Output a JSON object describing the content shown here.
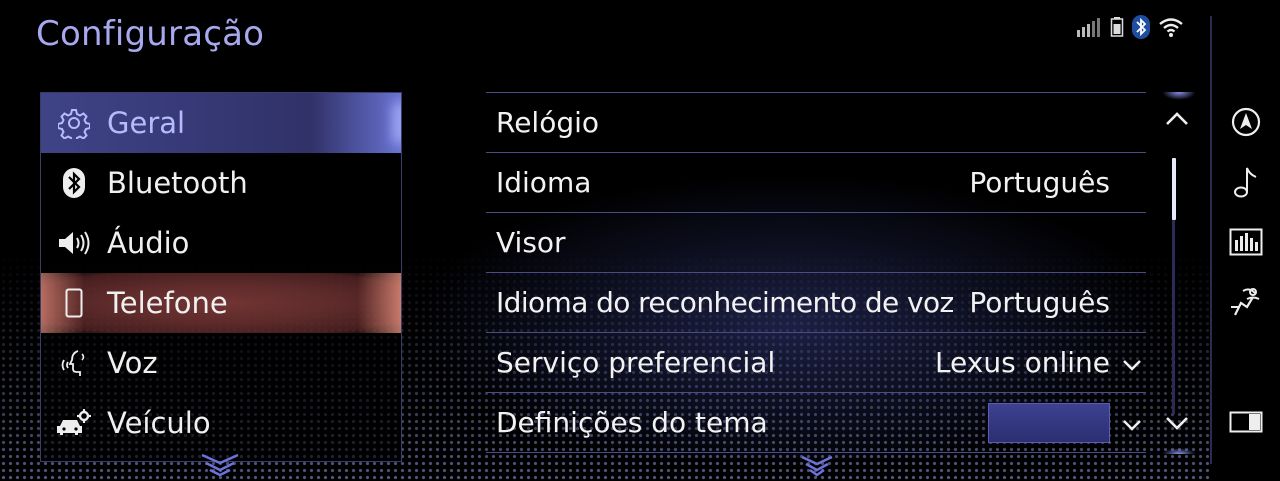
{
  "header": {
    "title": "Configuração"
  },
  "status": [
    "signal-icon",
    "phone-battery-icon",
    "bluetooth-icon",
    "wifi-icon"
  ],
  "menu": {
    "items": [
      {
        "label": "Geral",
        "icon": "gear-icon",
        "state": "selected"
      },
      {
        "label": "Bluetooth",
        "icon": "bluetooth-icon"
      },
      {
        "label": "Áudio",
        "icon": "speaker-icon"
      },
      {
        "label": "Telefone",
        "icon": "phone-icon",
        "state": "focused"
      },
      {
        "label": "Voz",
        "icon": "voice-icon"
      },
      {
        "label": "Veículo",
        "icon": "vehicle-settings-icon"
      }
    ]
  },
  "list": {
    "rows": [
      {
        "label": "Relógio",
        "value": ""
      },
      {
        "label": "Idioma",
        "value": "Português"
      },
      {
        "label": "Visor",
        "value": ""
      },
      {
        "label": "Idioma do reconhecimento de voz",
        "value": "Português"
      },
      {
        "label": "Serviço preferencial",
        "value": "Lexus online"
      },
      {
        "label": "Definições do tema",
        "value": ""
      }
    ]
  },
  "rail": [
    "navigation-icon",
    "music-note-icon",
    "equalizer-icon",
    "climate-seat-icon",
    "split-screen-icon"
  ],
  "colors": {
    "accent": "#a7a8ee",
    "selected_bg": "#3c3e82",
    "focus_glow": "#7a3a3a",
    "theme_swatch": "#3a3e8c"
  }
}
